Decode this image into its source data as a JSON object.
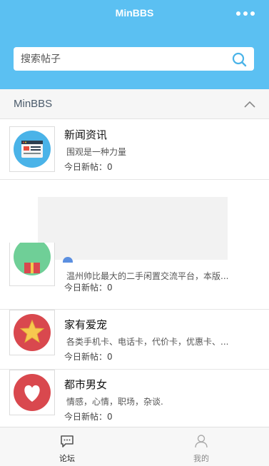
{
  "header": {
    "title": "MinBBS",
    "more_icon": "more-dots-icon"
  },
  "search": {
    "placeholder": "搜索帖子",
    "icon": "search-icon"
  },
  "section": {
    "title": "MinBBS",
    "toggle_icon": "chevron-up-icon"
  },
  "forums": [
    {
      "name": "新闻资讯",
      "desc": "围观是一种力量",
      "today": "今日新帖：0",
      "icon": "browser-window-icon"
    },
    {
      "name": "",
      "desc": "温州帅比最大的二手闲置交流平台，本版...",
      "today": "今日新帖：0",
      "icon": "gift-icon"
    },
    {
      "name": "家有爱宠",
      "desc": "各类手机卡、电话卡，代价卡，优惠卡、...",
      "today": "今日新帖：0",
      "icon": "star-icon"
    },
    {
      "name": "都市男女",
      "desc": "情感，心情，职场，杂谈.",
      "today": "今日新帖：0",
      "icon": "heart-icon"
    }
  ],
  "partial": {
    "paren": ")"
  },
  "tabs": [
    {
      "label": "论坛",
      "icon": "forum-chat-icon",
      "active": true
    },
    {
      "label": "我的",
      "icon": "user-profile-icon",
      "active": false
    }
  ],
  "colors": {
    "header_bg": "#5bc0f2",
    "accent": "#4ab3e8",
    "star_badge": "#d9484e",
    "heart_badge": "#d9484e"
  }
}
